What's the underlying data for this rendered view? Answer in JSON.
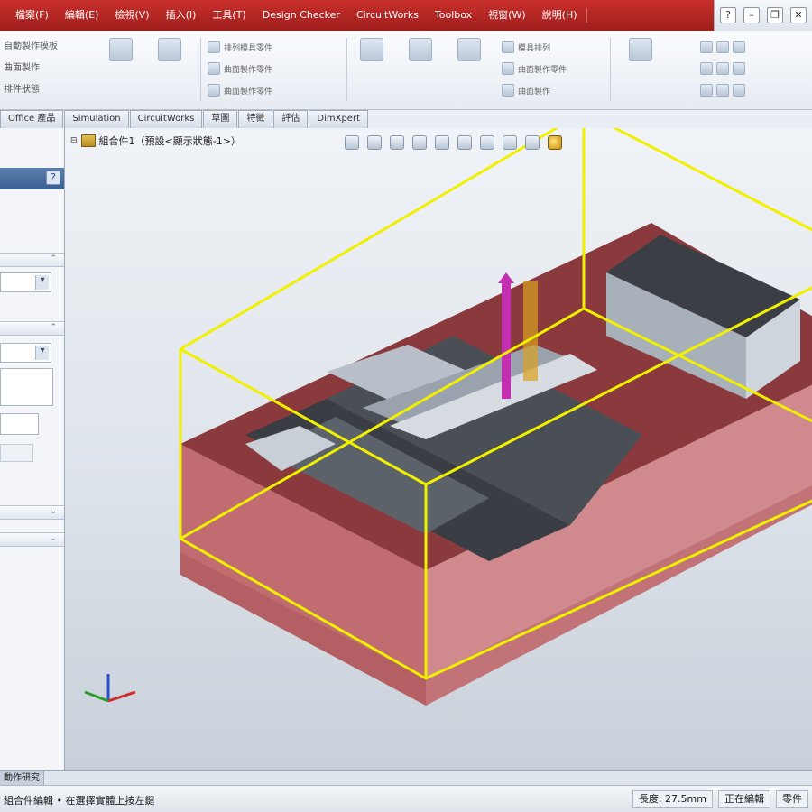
{
  "menubar": {
    "items": [
      "檔案(F)",
      "編輯(E)",
      "檢視(V)",
      "插入(I)",
      "工具(T)",
      "Design Checker",
      "CircuitWorks",
      "Toolbox",
      "視窗(W)",
      "說明(H)"
    ]
  },
  "ribbon": {
    "left_items": [
      "自動製作模板",
      "曲面製作",
      "排件狀態"
    ],
    "small_rows": [
      "排列模具零件",
      "曲面製作零件",
      "曲面製作零件"
    ],
    "right_rows": [
      "模具排列",
      "曲面製作零件",
      "曲面製作"
    ]
  },
  "tabs": [
    "Office 產品",
    "Simulation",
    "CircuitWorks",
    "草圖",
    "特徵",
    "評估",
    "DimXpert"
  ],
  "feature_tree": {
    "root_label": "組合件1（預設<顯示狀態-1>）"
  },
  "heads_up_icons": [
    "zoom-to-fit-icon",
    "zoom-to-area-icon",
    "previous-view-icon",
    "section-view-icon",
    "view-orientation-icon",
    "display-style-icon",
    "hide-show-icon",
    "edit-appearance-icon",
    "apply-scene-icon",
    "view-settings-icon"
  ],
  "status_tab_label": "動作研究",
  "status": {
    "message": "組合件編輯 • 在選擇實體上按左鍵",
    "length": "長度: 27.5mm",
    "mode": "正在編輯",
    "part": "零件"
  },
  "colors": {
    "menubar": "#b32824",
    "mold_top": "#8a3a3c",
    "mold_side": "#c9797d",
    "bounding_box": "#f0f000",
    "cavity": "#3a3e44"
  }
}
